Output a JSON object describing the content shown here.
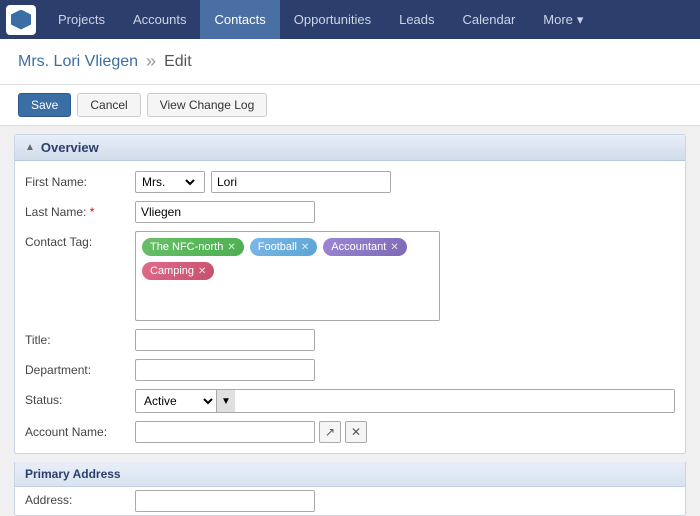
{
  "navbar": {
    "items": [
      {
        "label": "Projects",
        "active": false
      },
      {
        "label": "Accounts",
        "active": false
      },
      {
        "label": "Contacts",
        "active": true
      },
      {
        "label": "Opportunities",
        "active": false
      },
      {
        "label": "Leads",
        "active": false
      },
      {
        "label": "Calendar",
        "active": false
      },
      {
        "label": "More",
        "active": false
      }
    ]
  },
  "breadcrumb": {
    "name": "Mrs. Lori Vliegen",
    "separator": "»",
    "action": "Edit"
  },
  "toolbar": {
    "save_label": "Save",
    "cancel_label": "Cancel",
    "changelog_label": "View Change Log"
  },
  "overview": {
    "section_title": "Overview",
    "fields": {
      "first_name_label": "First Name:",
      "salutation": "Mrs.",
      "first_name": "Lori",
      "last_name_label": "Last Name:",
      "last_name": "Vliegen",
      "contact_tag_label": "Contact Tag:",
      "tags": [
        {
          "label": "The NFC-north",
          "class": "tag-nfc"
        },
        {
          "label": "Football",
          "class": "tag-football"
        },
        {
          "label": "Accountant",
          "class": "tag-accountant"
        },
        {
          "label": "Camping",
          "class": "tag-camping"
        }
      ],
      "title_label": "Title:",
      "department_label": "Department:",
      "status_label": "Status:",
      "status_value": "Active",
      "account_name_label": "Account Name:"
    }
  },
  "primary_address": {
    "section_title": "Primary Address",
    "address_label": "Address:"
  }
}
